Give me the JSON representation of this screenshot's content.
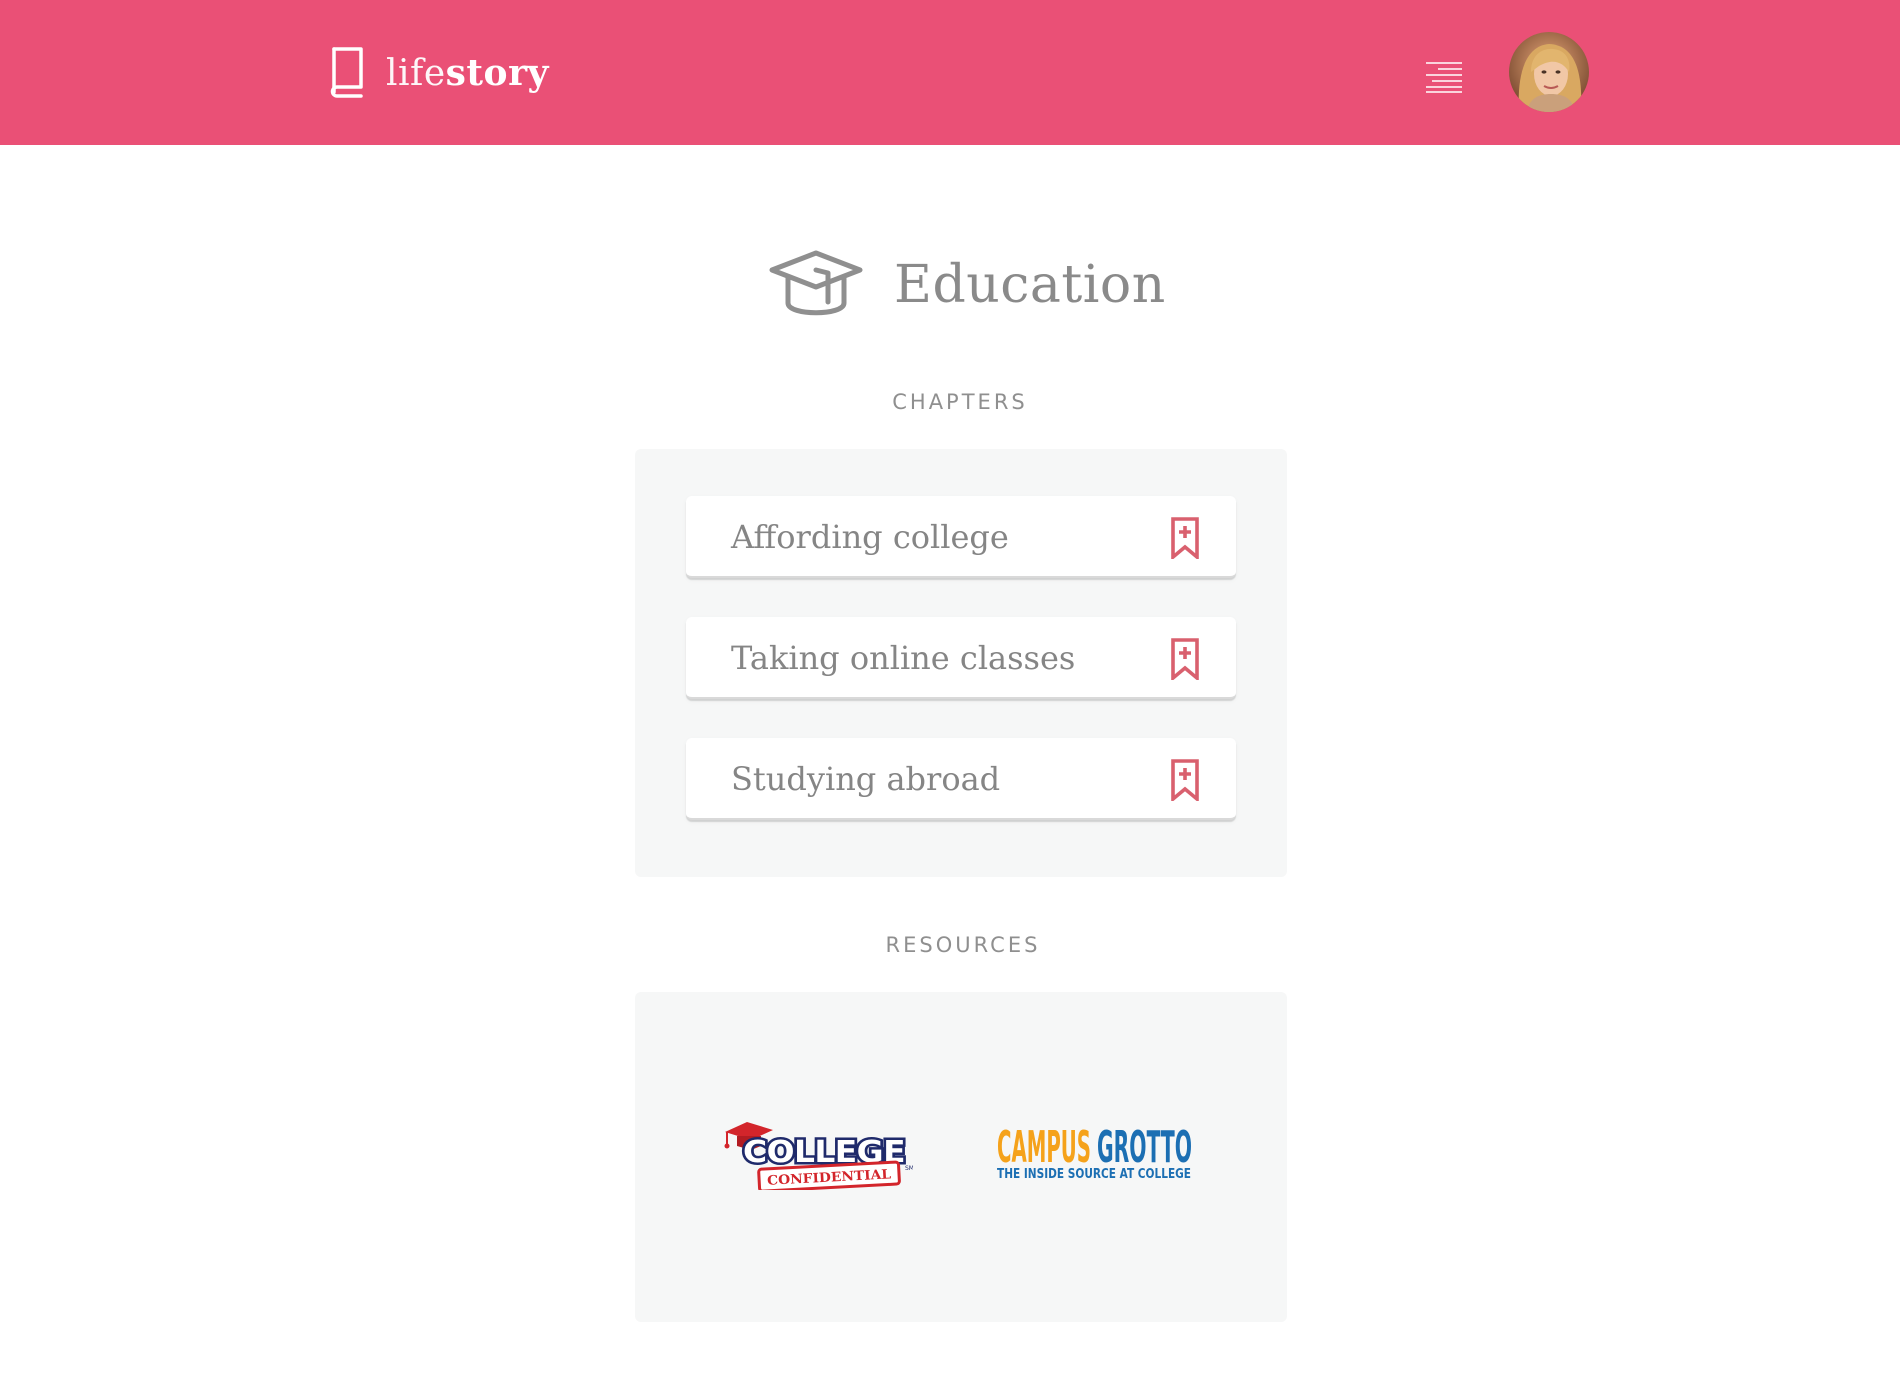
{
  "header": {
    "brand_light": "life",
    "brand_bold": "story",
    "bg_color": "#ea5076",
    "menu_icon": "menu-lines-icon",
    "avatar_icon": "user-avatar"
  },
  "page": {
    "title": "Education",
    "title_icon": "graduation-cap-icon"
  },
  "chapters": {
    "label": "CHAPTERS",
    "items": [
      {
        "label": "Affording college",
        "icon": "bookmark-add-icon"
      },
      {
        "label": "Taking online classes",
        "icon": "bookmark-add-icon"
      },
      {
        "label": "Studying abroad",
        "icon": "bookmark-add-icon"
      }
    ],
    "accent": "#d9606e"
  },
  "resources": {
    "label": "RESOURCES",
    "logos": [
      {
        "name": "college-confidential-logo",
        "line1": "COLLEGE",
        "line2": "CONFIDENTIAL",
        "mark": "SM"
      },
      {
        "name": "campus-grotto-logo",
        "word1": "CAMPUS",
        "word2": "GROTTO",
        "tagline": "THE INSIDE SOURCE AT COLLEGE"
      }
    ]
  }
}
